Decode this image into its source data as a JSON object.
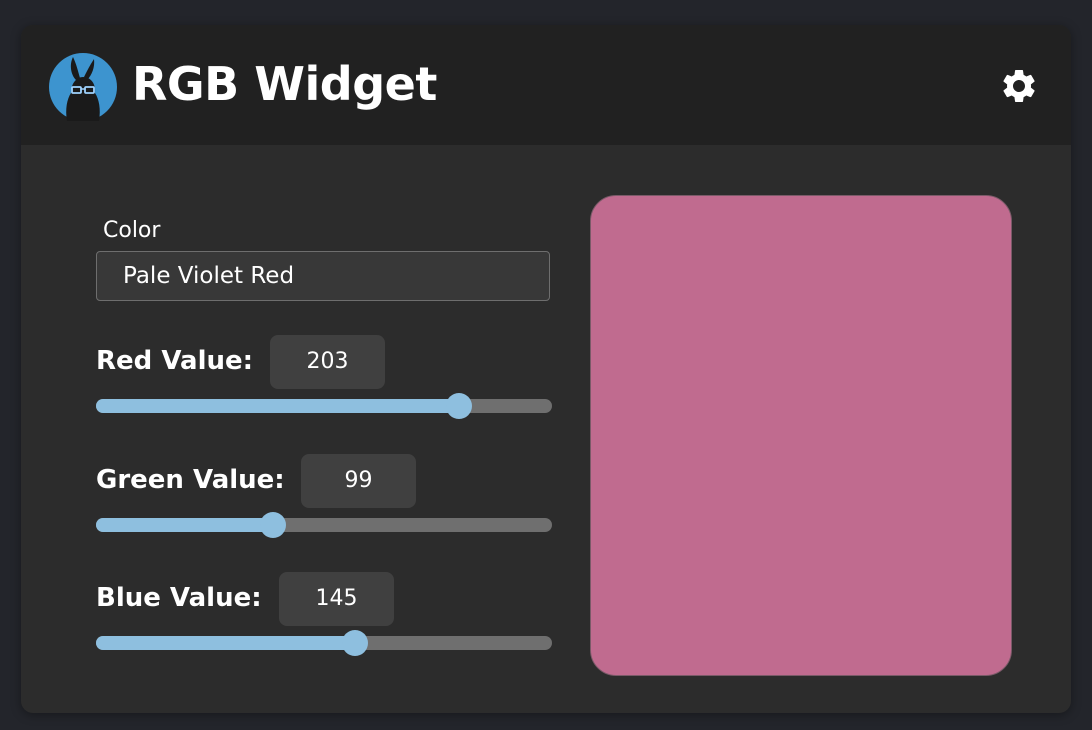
{
  "header": {
    "title": "RGB Widget",
    "logo_icon": "rabbit-with-glasses-logo-icon",
    "settings_icon": "gear-icon"
  },
  "color_field": {
    "label": "Color",
    "value": "Pale Violet Red"
  },
  "channels": [
    {
      "name": "red",
      "label": "Red Value:",
      "value": 203,
      "max": 255
    },
    {
      "name": "green",
      "label": "Green Value:",
      "value": 99,
      "max": 255
    },
    {
      "name": "blue",
      "label": "Blue Value:",
      "value": 145,
      "max": 255
    }
  ],
  "swatch": {
    "color": "#c06b8f"
  },
  "theme": {
    "accent": "#8ebfdf",
    "track": "#6f6f6f",
    "logo_blue": "#3d94cf"
  }
}
